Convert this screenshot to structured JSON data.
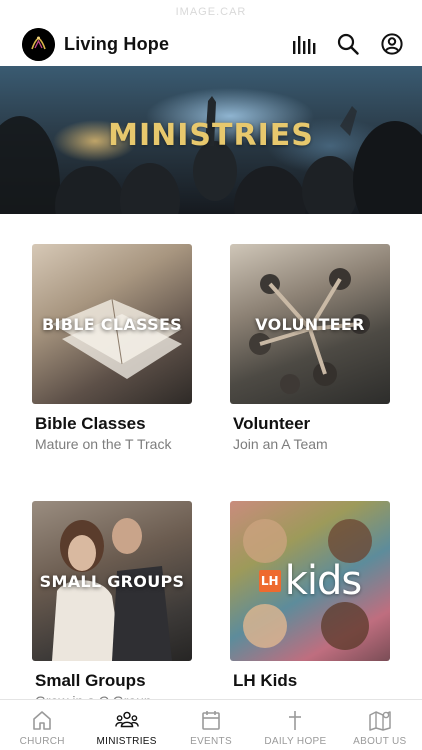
{
  "status_bar": {
    "text": "IMAGE.CAR"
  },
  "header": {
    "app_title": "Living Hope",
    "icons": [
      "audio-bars-icon",
      "search-icon",
      "profile-icon"
    ]
  },
  "hero": {
    "title": "MINISTRIES"
  },
  "cards": [
    {
      "overlay": "BIBLE CLASSES",
      "title": "Bible Classes",
      "subtitle": "Mature on the T Track"
    },
    {
      "overlay": "VOLUNTEER",
      "title": "Volunteer",
      "subtitle": "Join an A Team"
    },
    {
      "overlay": "SMALL GROUPS",
      "title": "Small Groups",
      "subtitle": "Grow in a C Group"
    },
    {
      "overlay_badge": "LH",
      "overlay_word": "kids",
      "title": "LH Kids",
      "subtitle": ""
    }
  ],
  "tabs": [
    {
      "label": "CHURCH",
      "icon": "home-icon",
      "active": false
    },
    {
      "label": "MINISTRIES",
      "icon": "people-group-icon",
      "active": true
    },
    {
      "label": "EVENTS",
      "icon": "calendar-icon",
      "active": false
    },
    {
      "label": "DAILY HOPE",
      "icon": "cross-icon",
      "active": false
    },
    {
      "label": "ABOUT US",
      "icon": "map-pin-icon",
      "active": false
    }
  ],
  "colors": {
    "hero_title": "#e7c86d",
    "active_tab": "#111111",
    "inactive_tab": "#9a9a9a",
    "lh_badge": "#ee6a2f"
  }
}
